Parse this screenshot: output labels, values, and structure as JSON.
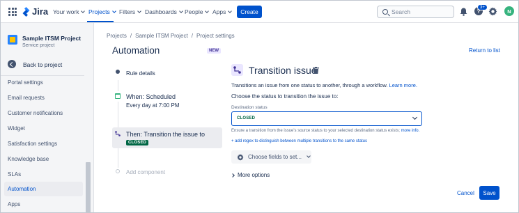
{
  "topnav": {
    "app_name": "Jira",
    "items": [
      "Your work",
      "Projects",
      "Filters",
      "Dashboards",
      "People",
      "Apps"
    ],
    "active_item": "Projects",
    "create_label": "Create",
    "search_placeholder": "Search",
    "notification_badge": "3+",
    "avatar_initial": "N",
    "accent_color": "#0052CC"
  },
  "sidebar": {
    "project_name": "Sample ITSM Project",
    "project_type": "Service project",
    "back_label": "Back to project",
    "items": [
      "Portal settings",
      "Email requests",
      "Customer notifications",
      "Widget",
      "Satisfaction settings",
      "Knowledge base",
      "SLAs",
      "Automation",
      "Apps"
    ],
    "active_item": "Automation"
  },
  "breadcrumb": [
    "Projects",
    "/",
    "Sample ITSM Project",
    "/",
    "Project settings"
  ],
  "page": {
    "title": "Automation",
    "new_badge": "NEW",
    "return_link": "Return to list"
  },
  "flow": {
    "rule_details": "Rule details",
    "when_title": "When: Scheduled",
    "when_sub": "Every day at 7:00 PM",
    "then_title": "Then: Transition the issue to",
    "then_status": "CLOSED",
    "add_component": "Add component"
  },
  "detail": {
    "title": "Transition issue",
    "desc": "Transitions an issue from one status to another, through a workflow.",
    "learn_more": "Learn more.",
    "choose_label": "Choose the status to transition the issue to:",
    "dest_label": "Destination status",
    "dest_value": "CLOSED",
    "ensure_text": "Ensure a transition from the issue's source status to your selected destination status exists;",
    "ensure_link": "more info.",
    "add_regex": "+ add regex to distinguish between multiple transitions to the same status",
    "fields_label": "Choose fields to set...",
    "more_options": "More options",
    "cancel_label": "Cancel",
    "save_label": "Save"
  }
}
